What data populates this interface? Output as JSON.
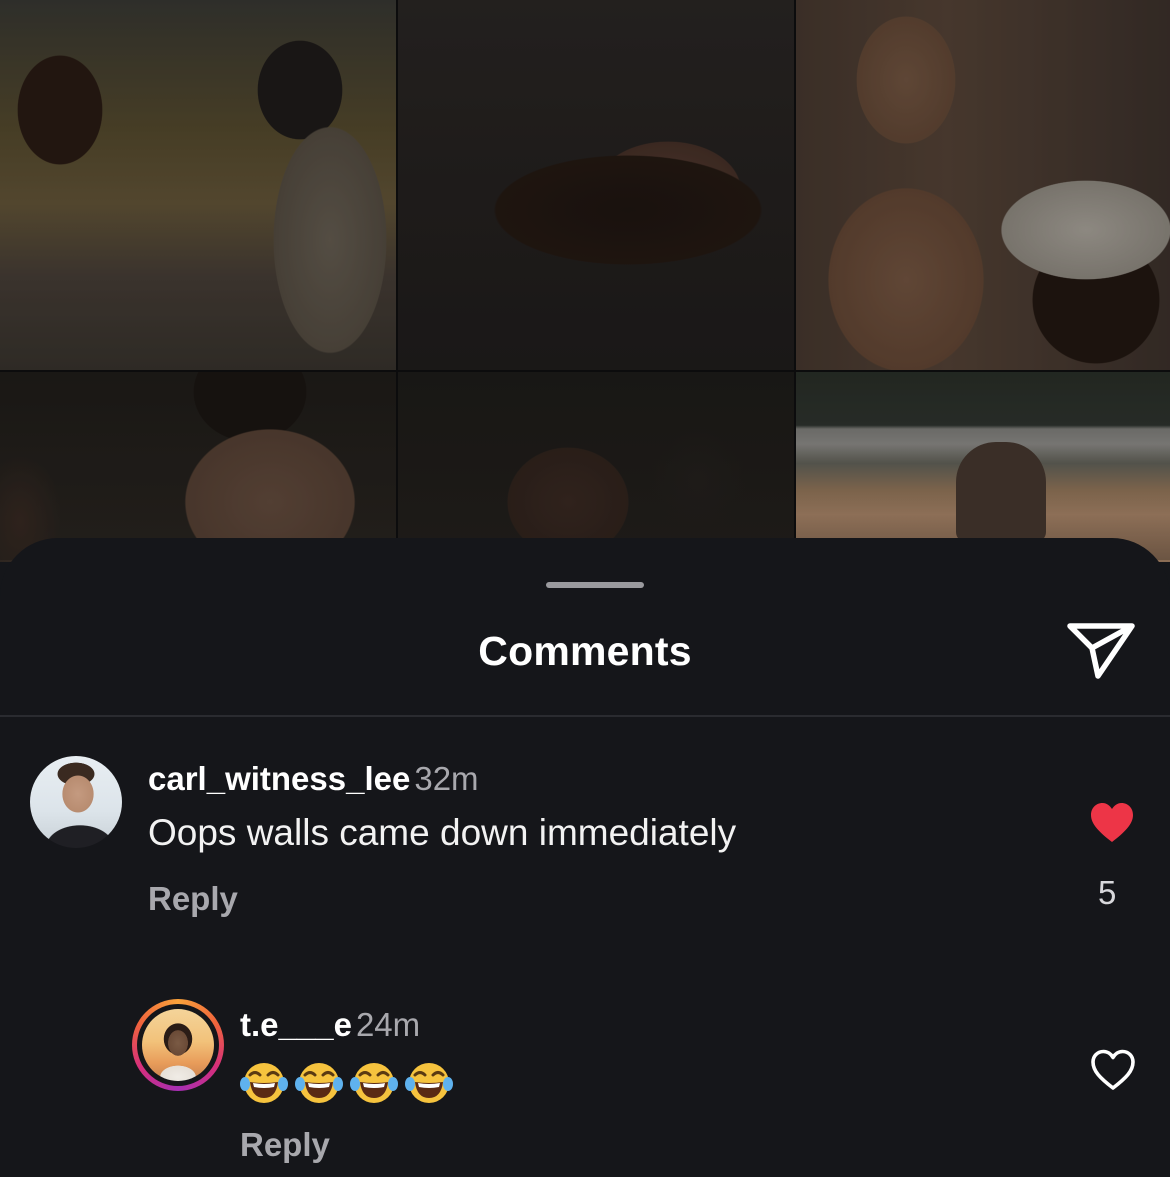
{
  "sheet": {
    "title": "Comments"
  },
  "comments": [
    {
      "username": "carl_witness_lee",
      "time": "32m",
      "text": "Oops walls came down immediately",
      "reply_label": "Reply",
      "liked": true,
      "like_count": "5"
    },
    {
      "username": "t.e___e",
      "time": "24m",
      "text": "😂😂😂😂",
      "reply_label": "Reply",
      "liked": false
    }
  ],
  "icons": {
    "send": "send-icon",
    "like_filled": "heart-filled-icon",
    "like_empty": "heart-outline-icon",
    "emoji": "tears-of-joy-emoji"
  },
  "colors": {
    "background": "#15161a",
    "like_red": "#ed3547",
    "story_ring": [
      "#f9a23b",
      "#f0643c",
      "#d62f7b",
      "#a62fb4"
    ]
  }
}
